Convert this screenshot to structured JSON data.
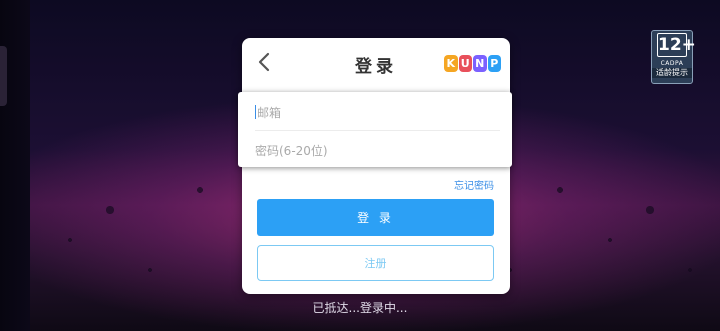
{
  "dialog": {
    "title": "登录",
    "logo_letters": [
      "K",
      "U",
      "N",
      "P",
      "O"
    ],
    "email_placeholder": "邮箱",
    "password_placeholder": "密码(6-20位)",
    "forgot_password": "忘记密码",
    "login_label": "登 录",
    "register_label": "注册"
  },
  "age_rating": {
    "number": "12+",
    "org": "CADPA",
    "tip": "适龄提示"
  },
  "status_text": "已抵达...登录中...",
  "colors": {
    "accent": "#2ca0f5",
    "register_border": "#7cc9f3",
    "link": "#3a8ee6"
  }
}
